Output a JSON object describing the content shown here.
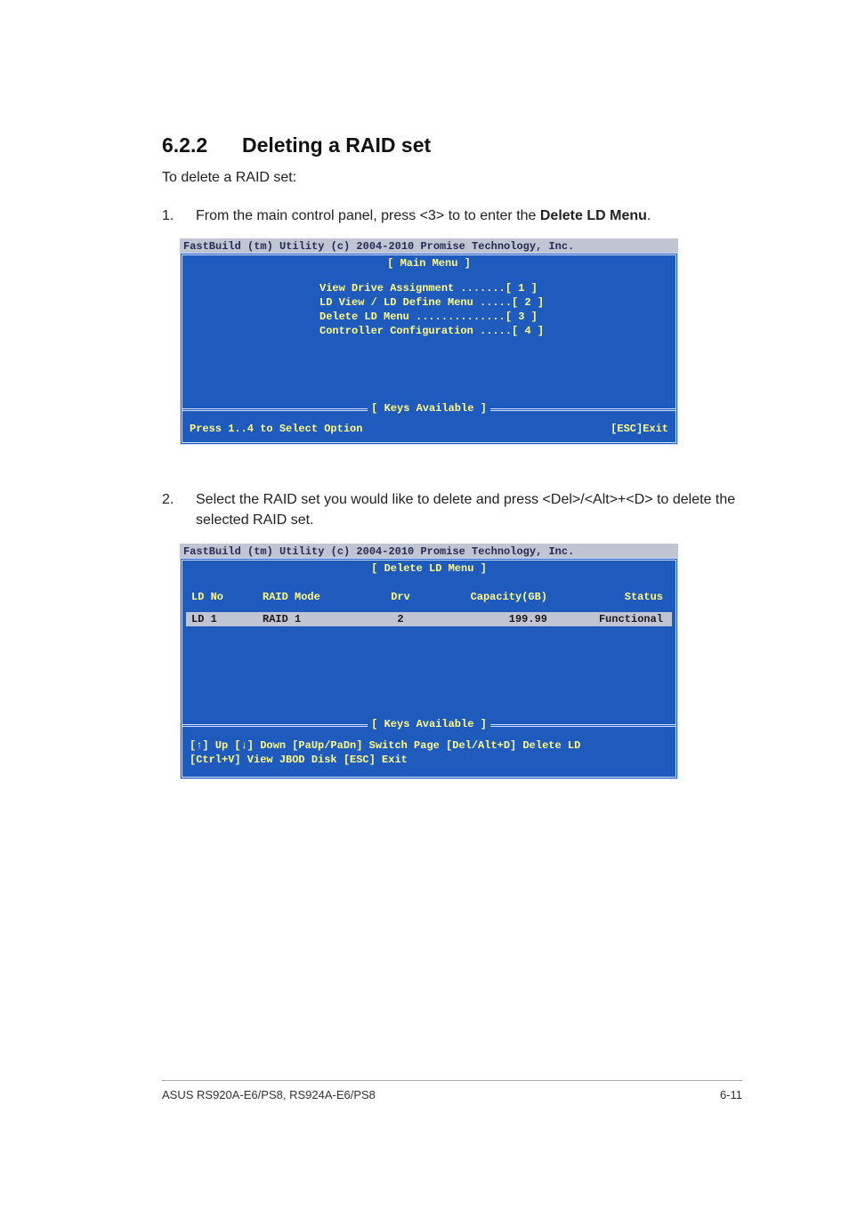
{
  "section": {
    "number": "6.2.2",
    "title": "Deleting a RAID set"
  },
  "intro": "To delete a RAID set:",
  "step1": {
    "num": "1.",
    "text_a": "From the main control panel, press <3> to to enter the ",
    "text_b": "Delete LD Menu",
    "text_c": "."
  },
  "bios1": {
    "header": "FastBuild (tm) Utility (c) 2004-2010 Promise Technology, Inc.",
    "title": "[ Main Menu ]",
    "menu": [
      "View Drive Assignment .......[ 1 ]",
      "LD View / LD Define Menu .....[ 2 ]",
      "Delete LD Menu ..............[ 3 ]",
      "Controller Configuration .....[ 4 ]"
    ],
    "keys_title": "[ Keys Available ]",
    "foot_left": "Press 1..4 to Select Option",
    "foot_right": "[ESC]Exit"
  },
  "step2": {
    "num": "2.",
    "text": "Select the RAID set you would like to delete and press <Del>/<Alt>+<D> to delete the selected RAID set."
  },
  "bios2": {
    "header": "FastBuild (tm) Utility (c) 2004-2010 Promise Technology, Inc.",
    "title": "[ Delete LD Menu ]",
    "cols": [
      "LD No",
      "RAID Mode",
      "Drv",
      "Capacity(GB)",
      "Status"
    ],
    "row": [
      "LD  1",
      "RAID 1",
      "2",
      "199.99",
      "Functional"
    ],
    "keys_title": "[ Keys Available ]",
    "keytext1": "[↑] Up [↓] Down [PaUp/PaDn] Switch Page [Del/Alt+D] Delete LD",
    "keytext2": "[Ctrl+V] View JBOD Disk  [ESC] Exit"
  },
  "footer": {
    "left": "ASUS RS920A-E6/PS8, RS924A-E6/PS8",
    "right": "6-11"
  }
}
